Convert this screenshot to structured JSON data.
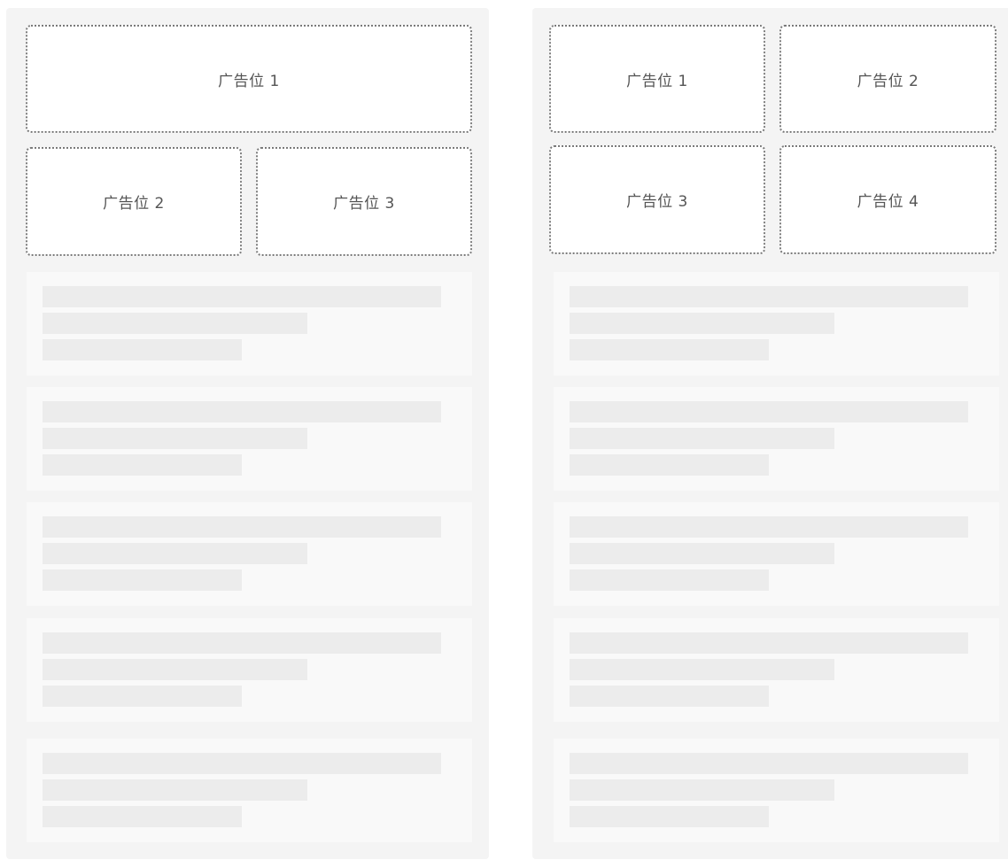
{
  "layout_a": {
    "ad_slots": [
      "广告位 1",
      "广告位 2",
      "广告位 3"
    ],
    "feed": {
      "placeholder_card_count": 5
    }
  },
  "layout_b": {
    "ad_slots": [
      "广告位 1",
      "广告位 2",
      "广告位 3",
      "广告位 4"
    ],
    "feed": {
      "placeholder_card_count": 5
    }
  },
  "colors": {
    "panel_background": "#f4f4f4",
    "ad_slot_background": "#ffffff",
    "ad_slot_border": "#7a7a7a",
    "ad_slot_text": "#555555",
    "skeleton_card": "#f9f9f9",
    "skeleton_line": "#ececec"
  }
}
